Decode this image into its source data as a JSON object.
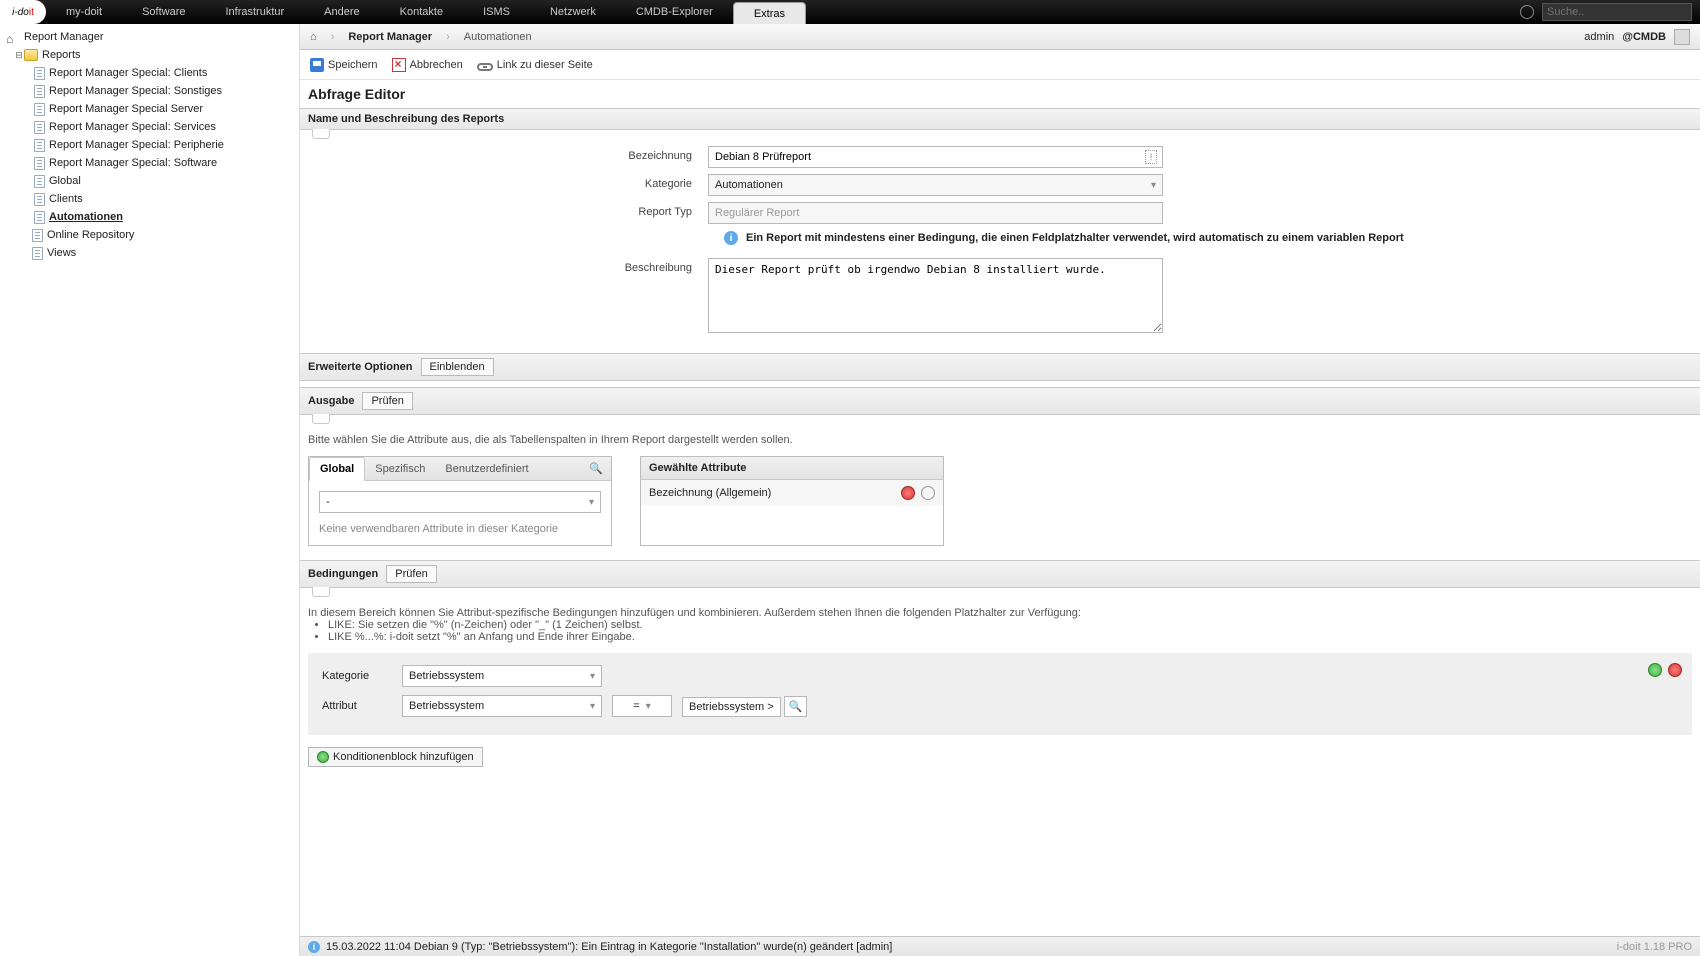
{
  "topnav": {
    "logo_a": "i-do",
    "logo_b": "it",
    "items": [
      "my-doit",
      "Software",
      "Infrastruktur",
      "Andere",
      "Kontakte",
      "ISMS",
      "Netzwerk",
      "CMDB-Explorer",
      "Extras"
    ],
    "active_index": 8,
    "search_placeholder": "Suche.."
  },
  "user": {
    "name": "admin",
    "tenant": "@CMDB"
  },
  "sidebar": {
    "root": "Report Manager",
    "reports_label": "Reports",
    "items": [
      "Report Manager Special: Clients",
      "Report Manager Special: Sonstiges",
      "Report Manager Special Server",
      "Report Manager Special: Services",
      "Report Manager Special: Peripherie",
      "Report Manager Special: Software",
      "Global",
      "Clients",
      "Automationen"
    ],
    "selected_index": 8,
    "online_repo": "Online Repository",
    "views": "Views"
  },
  "breadcrumb": {
    "a": "Report Manager",
    "b": "Automationen"
  },
  "toolbar": {
    "save": "Speichern",
    "cancel": "Abbrechen",
    "link": "Link zu dieser Seite"
  },
  "page_title": "Abfrage Editor",
  "sec1": {
    "head": "Name und Beschreibung des Reports",
    "bez_label": "Bezeichnung",
    "bez_value": "Debian 8 Prüfreport",
    "kat_label": "Kategorie",
    "kat_value": "Automationen",
    "typ_label": "Report Typ",
    "typ_value": "Regulärer Report",
    "info": "Ein Report mit mindestens einer Bedingung, die einen Feldplatzhalter verwendet, wird automatisch zu einem variablen Report",
    "desc_label": "Beschreibung",
    "desc_value": "Dieser Report prüft ob irgendwo Debian 8 installiert wurde."
  },
  "sec2": {
    "head": "Erweiterte Optionen",
    "btn": "Einblenden"
  },
  "sec3": {
    "head": "Ausgabe",
    "btn": "Prüfen",
    "help": "Bitte wählen Sie die Attribute aus, die als Tabellenspalten in Ihrem Report dargestellt werden sollen.",
    "tabs": [
      "Global",
      "Spezifisch",
      "Benutzerdefiniert"
    ],
    "tab_active": 0,
    "dropdown": "-",
    "empty": "Keine verwendbaren Attribute in dieser Kategorie",
    "chosen_head": "Gewählte Attribute",
    "chosen_item": "Bezeichnung (Allgemein)"
  },
  "sec4": {
    "head": "Bedingungen",
    "btn": "Prüfen",
    "desc": "In diesem Bereich können Sie Attribut-spezifische Bedingungen hinzufügen und kombinieren. Außerdem stehen Ihnen die folgenden Platzhalter zur Verfügung:",
    "li1": "LIKE: Sie setzen die \"%\" (n-Zeichen) oder \"_\" (1 Zeichen) selbst.",
    "li2": "LIKE %...%: i-doit setzt \"%\" an Anfang und Ende ihrer Eingabe.",
    "kat_label": "Kategorie",
    "kat_value": "Betriebssystem",
    "attr_label": "Attribut",
    "attr_value": "Betriebssystem",
    "op": "=",
    "result": "Betriebssystem >",
    "add_block": "Konditionenblock hinzufügen"
  },
  "status": {
    "text": "15.03.2022 11:04 Debian 9 (Typ: \"Betriebssystem\"): Ein Eintrag in Kategorie \"Installation\" wurde(n) geändert [admin]",
    "version": "i-doit 1.18 PRO"
  }
}
